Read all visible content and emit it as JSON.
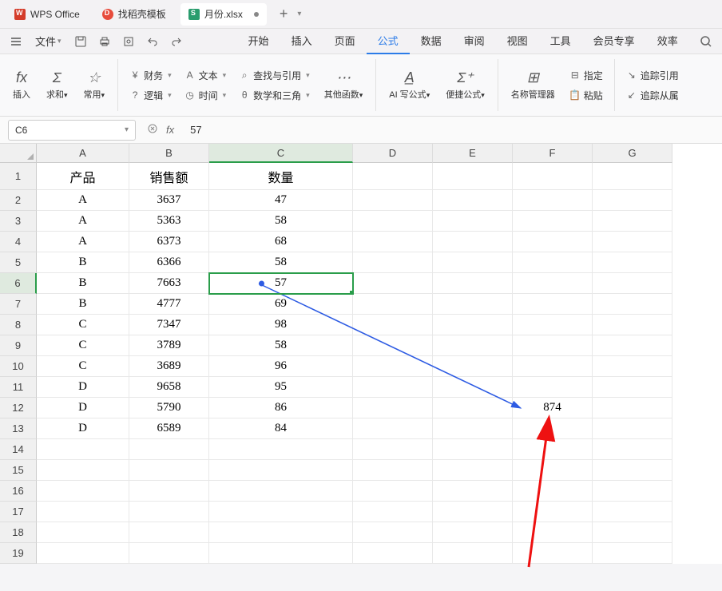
{
  "titlebar": {
    "app_name": "WPS Office",
    "template_tab": "找稻壳模板",
    "file_tab": "月份.xlsx",
    "add_tab": "+"
  },
  "menurow": {
    "file_menu": "文件",
    "tabs": [
      "开始",
      "插入",
      "页面",
      "公式",
      "数据",
      "审阅",
      "视图",
      "工具",
      "会员专享",
      "效率"
    ],
    "active_index": 3
  },
  "ribbon": {
    "insert_fx": "插入",
    "fx_symbol": "fx",
    "sum": "求和",
    "common": "常用",
    "finance": "财务",
    "text": "文本",
    "lookup": "查找与引用",
    "logic": "逻辑",
    "time": "时间",
    "math": "数学和三角",
    "other": "其他函数",
    "ai_formula": "AI 写公式",
    "quick_formula": "便捷公式",
    "name_mgr": "名称管理器",
    "assign": "指定",
    "paste": "粘贴",
    "trace_precedents": "追踪引用",
    "trace_dependents": "追踪从属"
  },
  "formulabar": {
    "name_box": "C6",
    "fx_symbol": "fx",
    "formula_value": "57"
  },
  "sheet": {
    "col_widths": {
      "A": 116,
      "B": 100,
      "C": 180,
      "D": 100,
      "E": 100,
      "F": 100,
      "G": 100
    },
    "row_heights": {
      "header": 34,
      "data": 26
    },
    "columns": [
      "A",
      "B",
      "C",
      "D",
      "E",
      "F",
      "G"
    ],
    "selected_col": "C",
    "selected_row": 6,
    "headers": [
      "产品",
      "销售额",
      "数量"
    ],
    "data": [
      [
        "A",
        "3637",
        "47"
      ],
      [
        "A",
        "5363",
        "58"
      ],
      [
        "A",
        "6373",
        "68"
      ],
      [
        "B",
        "6366",
        "58"
      ],
      [
        "B",
        "7663",
        "57"
      ],
      [
        "B",
        "4777",
        "69"
      ],
      [
        "C",
        "7347",
        "98"
      ],
      [
        "C",
        "3789",
        "58"
      ],
      [
        "C",
        "3689",
        "96"
      ],
      [
        "D",
        "9658",
        "95"
      ],
      [
        "D",
        "5790",
        "86"
      ],
      [
        "D",
        "6589",
        "84"
      ]
    ],
    "extra_cell": {
      "row": 12,
      "col": "F",
      "value": "874"
    },
    "blank_rows_after": 6,
    "total_rows": 19
  }
}
